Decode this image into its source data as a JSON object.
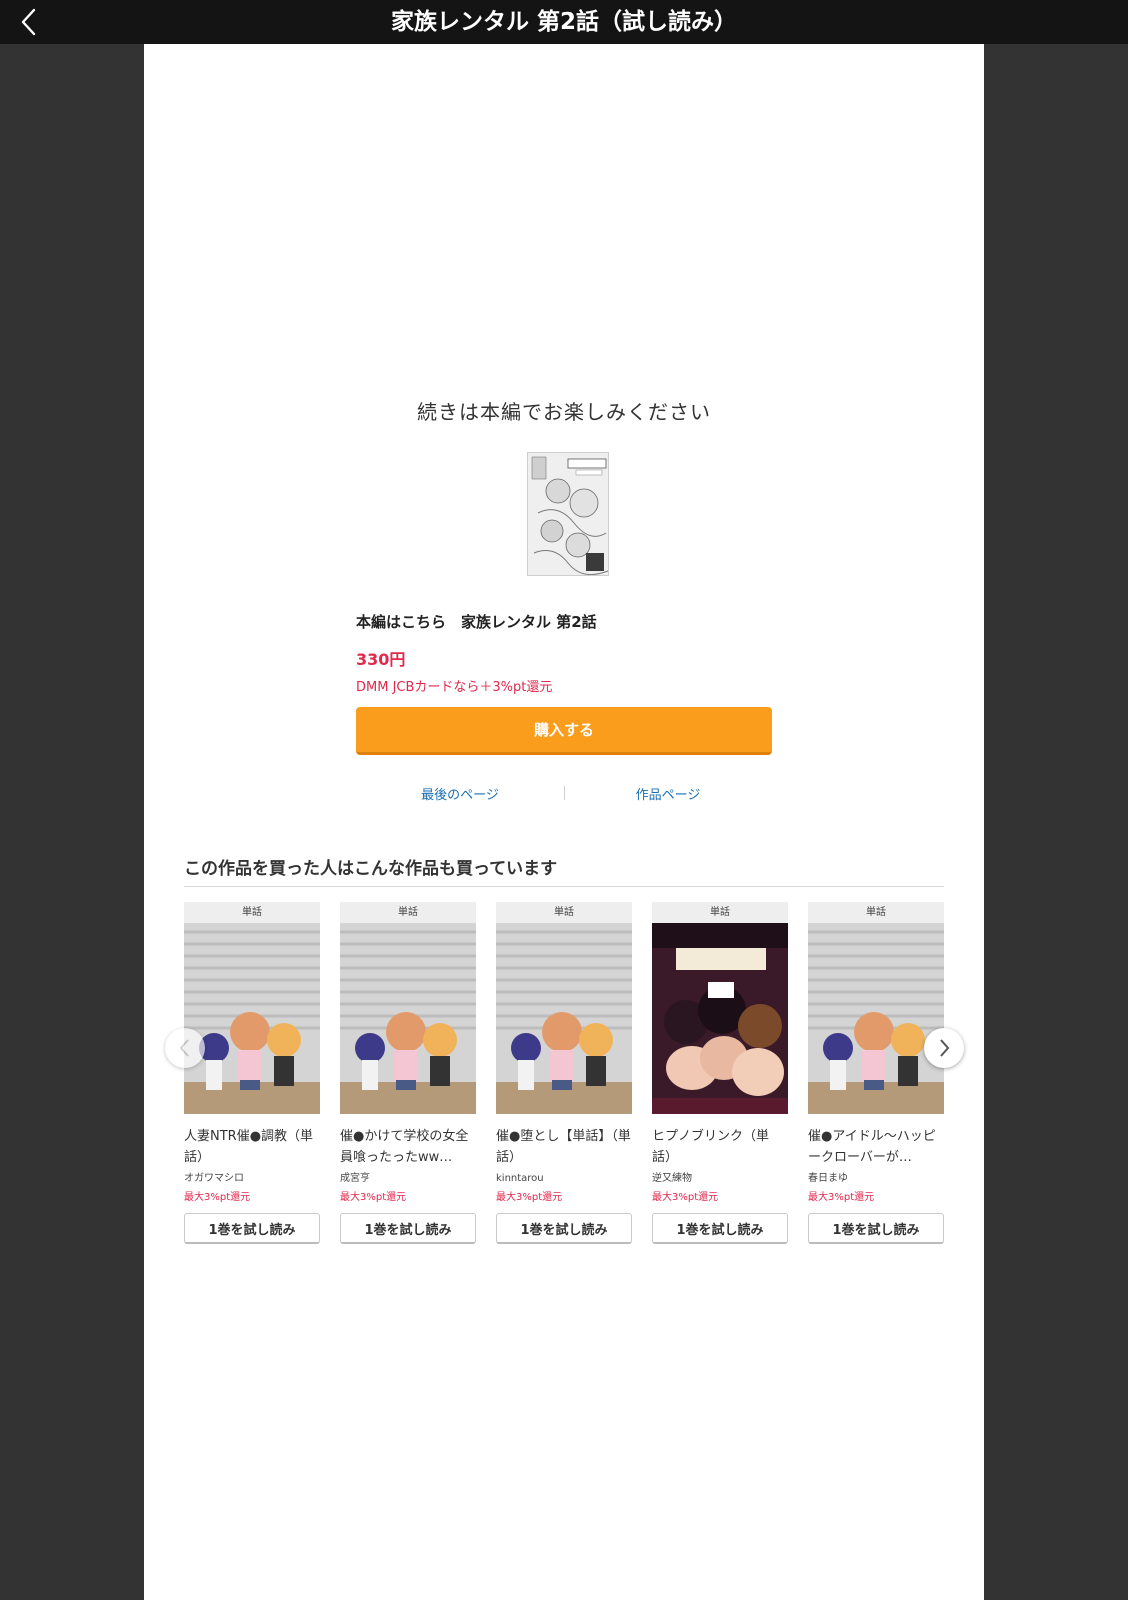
{
  "header": {
    "title": "家族レンタル 第2話（試し読み）"
  },
  "end_screen": {
    "message": "続きは本編でお楽しみください"
  },
  "purchase": {
    "title": "本編はこちら　家族レンタル 第2話",
    "price": "330円",
    "cashback": "DMM JCBカードなら＋3%pt還元",
    "buy_label": "購入する",
    "accent_color": "#fa9d1c"
  },
  "links": {
    "last_page": "最後のページ",
    "work_page": "作品ページ"
  },
  "recommendations": {
    "heading": "この作品を買った人はこんな作品も買っています",
    "items": [
      {
        "badge": "単話",
        "title": "人妻NTR催●調教（単話）",
        "author": "オガワマシロ",
        "points": "最大3%pt還元",
        "trial_label": "1巻を試し読み"
      },
      {
        "badge": "単話",
        "title": "催●かけて学校の女全員喰ったったww…",
        "author": "成宮亨",
        "points": "最大3%pt還元",
        "trial_label": "1巻を試し読み"
      },
      {
        "badge": "単話",
        "title": "催●堕とし【単話】（単話）",
        "author": "kinntarou",
        "points": "最大3%pt還元",
        "trial_label": "1巻を試し読み"
      },
      {
        "badge": "単話",
        "title": "ヒプノブリンク（単話）",
        "author": "逆又練物",
        "points": "最大3%pt還元",
        "trial_label": "1巻を試し読み"
      },
      {
        "badge": "単話",
        "title": "催●アイドル～ハッピークローバーが…",
        "author": "春日まゆ",
        "points": "最大3%pt還元",
        "trial_label": "1巻を試し読み"
      }
    ]
  }
}
